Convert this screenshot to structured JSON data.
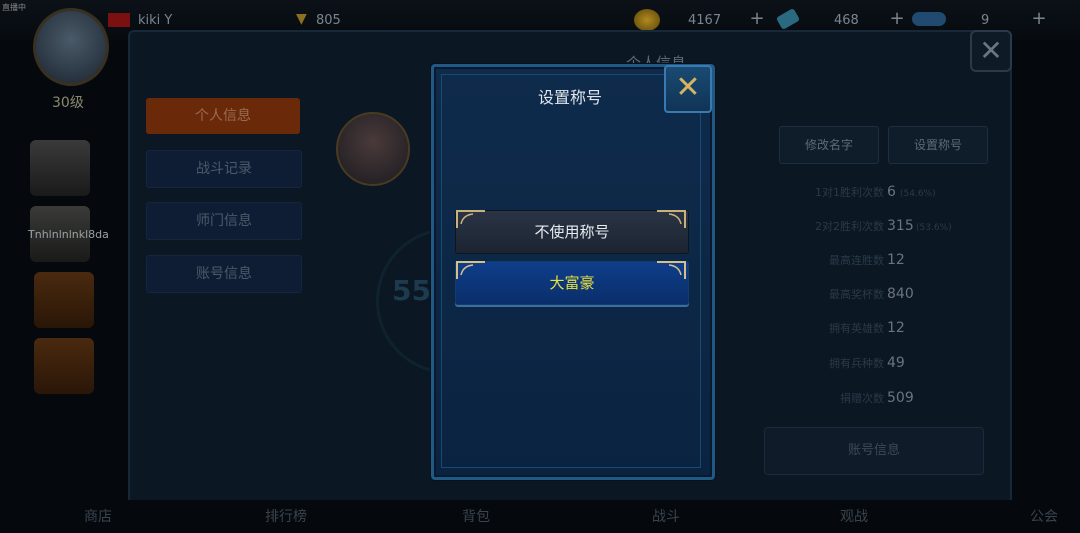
{
  "top_bar": {
    "status_text": "直播中",
    "nickname": "kiki Y",
    "trophy_count": "805",
    "gold": "4167",
    "gems": "468",
    "diamonds": "9",
    "plus_symbol": "+"
  },
  "left_column": {
    "level": "30级",
    "chest_label": "Tnhlnlnlnkl8da"
  },
  "background_panel": {
    "title": "个人信息",
    "side_menu": [
      "个人信息",
      "战斗记录",
      "师门信息",
      "账号信息"
    ],
    "score_partial": "55",
    "right_buttons": [
      "修改名字",
      "设置称号"
    ],
    "stats": [
      {
        "label": "1对1胜利次数",
        "value": "6",
        "sub": "(54.6%)"
      },
      {
        "label": "2对2胜利次数",
        "value": "315",
        "sub": "(53.6%)"
      },
      {
        "label": "最高连胜数",
        "value": "12",
        "sub": ""
      },
      {
        "label": "最高奖杯数",
        "value": "840",
        "sub": ""
      },
      {
        "label": "拥有英雄数",
        "value": "12",
        "sub": ""
      },
      {
        "label": "拥有兵种数",
        "value": "49",
        "sub": ""
      },
      {
        "label": "捐赠次数",
        "value": "509",
        "sub": ""
      }
    ],
    "account_button": "账号信息"
  },
  "bottom_nav": [
    "商店",
    "排行榜",
    "背包",
    "战斗",
    "观战",
    "公会"
  ],
  "modal": {
    "title": "设置称号",
    "options": [
      "不使用称号",
      "大富豪"
    ],
    "close_icon": "close-x-icon"
  },
  "colors": {
    "modal_bg": "#0f2b4c",
    "modal_border": "#1f5a86",
    "selected_title_text": "#e8e040",
    "close_x": "#d8b460"
  }
}
